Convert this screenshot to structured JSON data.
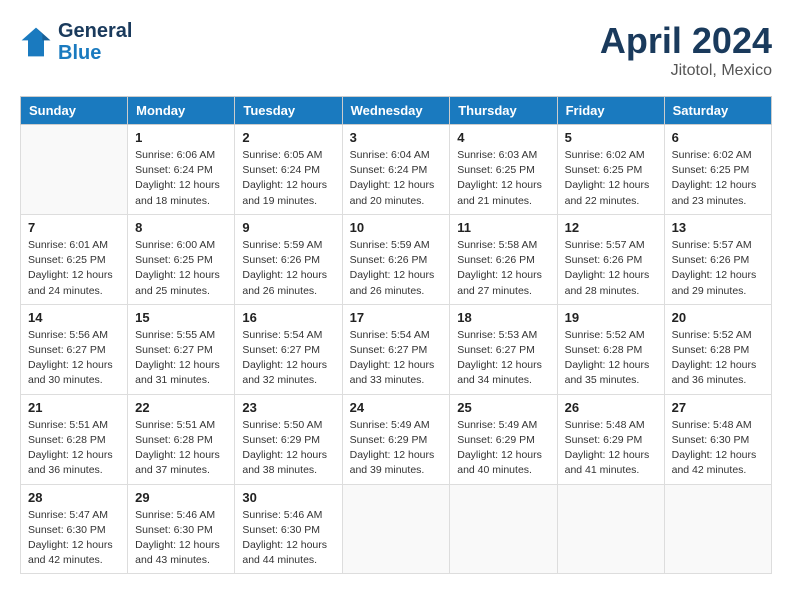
{
  "header": {
    "logo_line1": "General",
    "logo_line2": "Blue",
    "month": "April 2024",
    "location": "Jitotol, Mexico"
  },
  "weekdays": [
    "Sunday",
    "Monday",
    "Tuesday",
    "Wednesday",
    "Thursday",
    "Friday",
    "Saturday"
  ],
  "weeks": [
    [
      {
        "day": "",
        "info": ""
      },
      {
        "day": "1",
        "info": "Sunrise: 6:06 AM\nSunset: 6:24 PM\nDaylight: 12 hours\nand 18 minutes."
      },
      {
        "day": "2",
        "info": "Sunrise: 6:05 AM\nSunset: 6:24 PM\nDaylight: 12 hours\nand 19 minutes."
      },
      {
        "day": "3",
        "info": "Sunrise: 6:04 AM\nSunset: 6:24 PM\nDaylight: 12 hours\nand 20 minutes."
      },
      {
        "day": "4",
        "info": "Sunrise: 6:03 AM\nSunset: 6:25 PM\nDaylight: 12 hours\nand 21 minutes."
      },
      {
        "day": "5",
        "info": "Sunrise: 6:02 AM\nSunset: 6:25 PM\nDaylight: 12 hours\nand 22 minutes."
      },
      {
        "day": "6",
        "info": "Sunrise: 6:02 AM\nSunset: 6:25 PM\nDaylight: 12 hours\nand 23 minutes."
      }
    ],
    [
      {
        "day": "7",
        "info": "Sunrise: 6:01 AM\nSunset: 6:25 PM\nDaylight: 12 hours\nand 24 minutes."
      },
      {
        "day": "8",
        "info": "Sunrise: 6:00 AM\nSunset: 6:25 PM\nDaylight: 12 hours\nand 25 minutes."
      },
      {
        "day": "9",
        "info": "Sunrise: 5:59 AM\nSunset: 6:26 PM\nDaylight: 12 hours\nand 26 minutes."
      },
      {
        "day": "10",
        "info": "Sunrise: 5:59 AM\nSunset: 6:26 PM\nDaylight: 12 hours\nand 26 minutes."
      },
      {
        "day": "11",
        "info": "Sunrise: 5:58 AM\nSunset: 6:26 PM\nDaylight: 12 hours\nand 27 minutes."
      },
      {
        "day": "12",
        "info": "Sunrise: 5:57 AM\nSunset: 6:26 PM\nDaylight: 12 hours\nand 28 minutes."
      },
      {
        "day": "13",
        "info": "Sunrise: 5:57 AM\nSunset: 6:26 PM\nDaylight: 12 hours\nand 29 minutes."
      }
    ],
    [
      {
        "day": "14",
        "info": "Sunrise: 5:56 AM\nSunset: 6:27 PM\nDaylight: 12 hours\nand 30 minutes."
      },
      {
        "day": "15",
        "info": "Sunrise: 5:55 AM\nSunset: 6:27 PM\nDaylight: 12 hours\nand 31 minutes."
      },
      {
        "day": "16",
        "info": "Sunrise: 5:54 AM\nSunset: 6:27 PM\nDaylight: 12 hours\nand 32 minutes."
      },
      {
        "day": "17",
        "info": "Sunrise: 5:54 AM\nSunset: 6:27 PM\nDaylight: 12 hours\nand 33 minutes."
      },
      {
        "day": "18",
        "info": "Sunrise: 5:53 AM\nSunset: 6:27 PM\nDaylight: 12 hours\nand 34 minutes."
      },
      {
        "day": "19",
        "info": "Sunrise: 5:52 AM\nSunset: 6:28 PM\nDaylight: 12 hours\nand 35 minutes."
      },
      {
        "day": "20",
        "info": "Sunrise: 5:52 AM\nSunset: 6:28 PM\nDaylight: 12 hours\nand 36 minutes."
      }
    ],
    [
      {
        "day": "21",
        "info": "Sunrise: 5:51 AM\nSunset: 6:28 PM\nDaylight: 12 hours\nand 36 minutes."
      },
      {
        "day": "22",
        "info": "Sunrise: 5:51 AM\nSunset: 6:28 PM\nDaylight: 12 hours\nand 37 minutes."
      },
      {
        "day": "23",
        "info": "Sunrise: 5:50 AM\nSunset: 6:29 PM\nDaylight: 12 hours\nand 38 minutes."
      },
      {
        "day": "24",
        "info": "Sunrise: 5:49 AM\nSunset: 6:29 PM\nDaylight: 12 hours\nand 39 minutes."
      },
      {
        "day": "25",
        "info": "Sunrise: 5:49 AM\nSunset: 6:29 PM\nDaylight: 12 hours\nand 40 minutes."
      },
      {
        "day": "26",
        "info": "Sunrise: 5:48 AM\nSunset: 6:29 PM\nDaylight: 12 hours\nand 41 minutes."
      },
      {
        "day": "27",
        "info": "Sunrise: 5:48 AM\nSunset: 6:30 PM\nDaylight: 12 hours\nand 42 minutes."
      }
    ],
    [
      {
        "day": "28",
        "info": "Sunrise: 5:47 AM\nSunset: 6:30 PM\nDaylight: 12 hours\nand 42 minutes."
      },
      {
        "day": "29",
        "info": "Sunrise: 5:46 AM\nSunset: 6:30 PM\nDaylight: 12 hours\nand 43 minutes."
      },
      {
        "day": "30",
        "info": "Sunrise: 5:46 AM\nSunset: 6:30 PM\nDaylight: 12 hours\nand 44 minutes."
      },
      {
        "day": "",
        "info": ""
      },
      {
        "day": "",
        "info": ""
      },
      {
        "day": "",
        "info": ""
      },
      {
        "day": "",
        "info": ""
      }
    ]
  ]
}
